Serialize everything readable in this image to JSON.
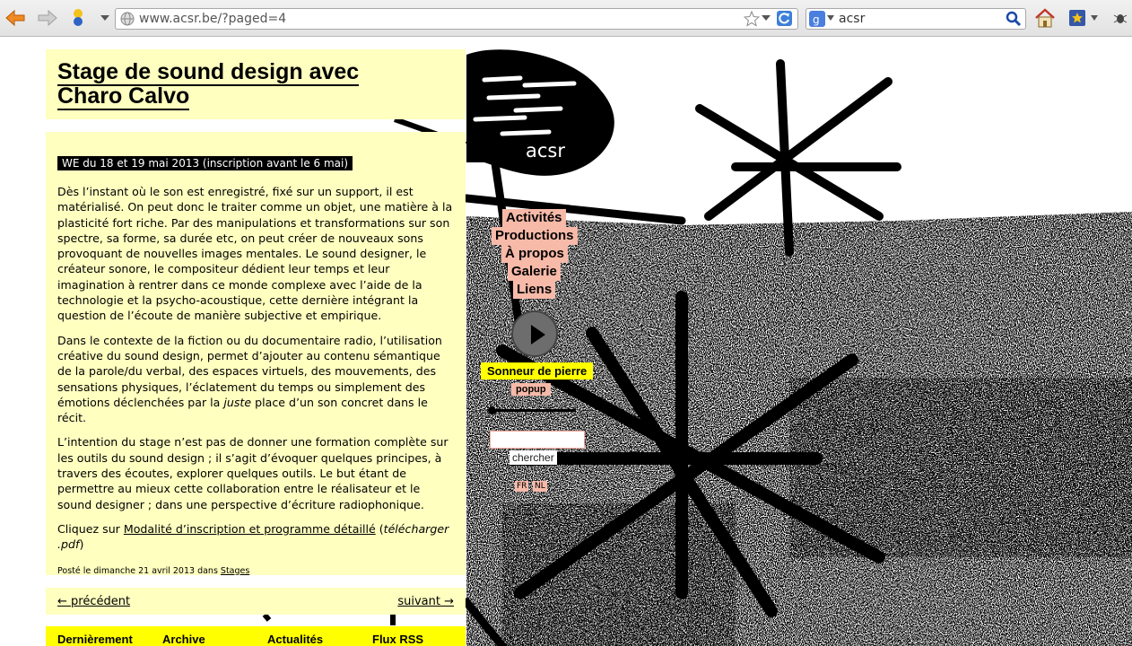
{
  "browser": {
    "url": "www.acsr.be/?paged=4",
    "search_query": "acsr"
  },
  "post": {
    "title_line1": "Stage de sound design avec",
    "title_line2": "Charo Calvo",
    "date_badge": "WE du  18 et 19 mai 2013 (inscription avant le 6 mai)",
    "paragraph1": "Dès l’instant où le son est enregistré, fixé sur un support, il est matéria­lisé. On peut donc le traiter comme un objet, une matière à la plasticité fort riche. Par des manipulations et transformations sur son spectre, sa forme, sa durée etc, on peut créer de nouveaux sons provoquant de nouvelles images mentales. Le sound designer, le créateur sonore, le compositeur dédient leur temps et leur imagination à rentrer dans ce monde complexe avec l’aide de la technologie et la psycho-acoustique, cette dernière intégrant la question de l’écoute de manière subjective et empirique.",
    "paragraph2_before": "Dans le contexte de la fiction ou du documentaire radio, l’utilisation créative du sound design, permet d’ajouter au contenu sémantique de la parole/du verbal, des espaces virtuels, des mouvements, des sensations physiques, l’éclatement du temps ou simplement des émotions déclen­chées par la ",
    "paragraph2_emphasis": "juste",
    "paragraph2_after": " place d’un son concret dans le récit.",
    "paragraph3": "L’intention du stage n’est pas de donner une formation complète sur les outils du sound design ; il s’agit d’évoquer quelques principes, à tra­vers des écoutes, explorer quelques outils. Le but étant de permettre au mieux cette collaboration entre le réalisateur et le sound designer ; dans une perspective d’écriture radiophonique.",
    "cta_prefix": "Cliquez sur ",
    "cta_link": "Modalité d’inscription et programme détaillé",
    "cta_middle": " (",
    "cta_download": "télécharger .pdf",
    "cta_suffix": ")",
    "posted_prefix": "Posté le dimanche 21 avril 2013 dans ",
    "posted_category": "Stages"
  },
  "pager": {
    "previous": "← précédent",
    "next": "suivant →"
  },
  "footer": {
    "items": [
      "Dernièrement",
      "Archive",
      "Actualités",
      "Flux RSS"
    ]
  },
  "site": {
    "logo_text": "acsr",
    "menu": [
      "Activités",
      "Productions",
      "À propos",
      "Galerie",
      "Liens"
    ],
    "player_label": "Sonneur de pierre",
    "popup_label": "popup",
    "search_button": "chercher",
    "languages": [
      "FR",
      "NL"
    ]
  },
  "colors": {
    "content_bg": "#ffffc0",
    "accent_yellow": "#ffff00",
    "menu_pink": "#f7b9a8"
  }
}
